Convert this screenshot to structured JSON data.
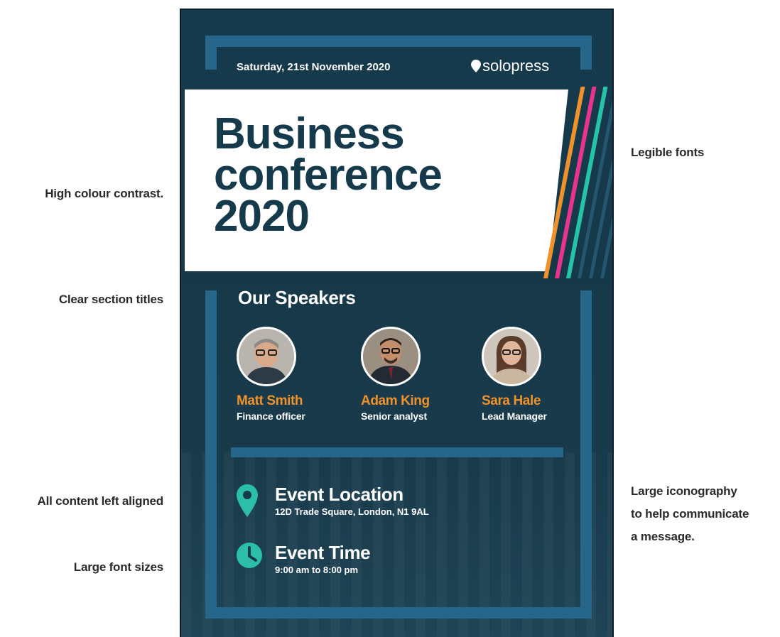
{
  "annotations": {
    "left": [
      "High colour contrast.",
      "Clear section titles",
      "All content left aligned",
      "Large font sizes"
    ],
    "right": [
      "Legible fonts",
      "Large iconography",
      "to help communicate",
      "a message."
    ]
  },
  "poster": {
    "date": "Saturday, 21st November 2020",
    "brand": "solopress",
    "title_lines": [
      "Business",
      "conference",
      "2020"
    ],
    "speakers_title": "Our Speakers",
    "speakers": [
      {
        "name": "Matt Smith",
        "role": "Finance officer"
      },
      {
        "name": "Adam King",
        "role": "Senior analyst"
      },
      {
        "name": "Sara Hale",
        "role": "Lead Manager"
      }
    ],
    "location": {
      "heading": "Event Location",
      "detail": "12D Trade Square, London, N1 9AL",
      "icon": "map-pin-icon"
    },
    "time": {
      "heading": "Event Time",
      "detail": "9:00 am to 8:00 pm",
      "icon": "clock-icon"
    }
  },
  "colors": {
    "background": "#153a4c",
    "frame": "#26668a",
    "accent_name": "#f0922b",
    "icon_teal": "#2bbfa8",
    "stripe_orange": "#f0922b",
    "stripe_pink": "#e8348a",
    "stripe_teal": "#25c3a7",
    "title_text": "#153a4c"
  }
}
